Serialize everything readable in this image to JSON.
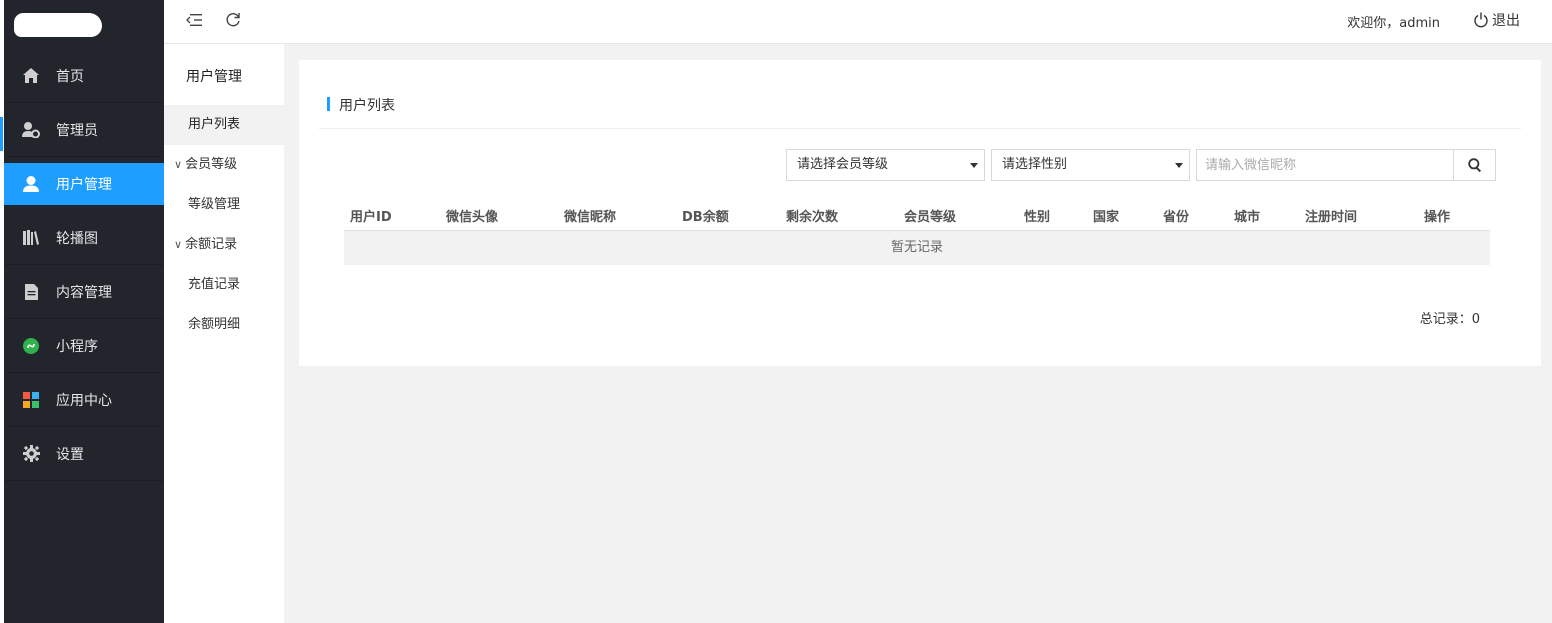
{
  "sidebar": {
    "logo_alt": "",
    "items": [
      {
        "label": "首页",
        "icon": "home-icon"
      },
      {
        "label": "管理员",
        "icon": "admin-user-icon"
      },
      {
        "label": "用户管理",
        "icon": "user-icon"
      },
      {
        "label": "轮播图",
        "icon": "books-icon"
      },
      {
        "label": "内容管理",
        "icon": "document-icon"
      },
      {
        "label": "小程序",
        "icon": "miniprogram-icon"
      },
      {
        "label": "应用中心",
        "icon": "apps-icon"
      },
      {
        "label": "设置",
        "icon": "gear-icon"
      }
    ],
    "active_color": "#1e9fff",
    "background": "#22252c"
  },
  "subnav": {
    "title": "用户管理",
    "items": [
      {
        "label": "用户列表",
        "active": true
      },
      {
        "label": "会员等级",
        "group": true
      },
      {
        "label": "等级管理"
      },
      {
        "label": "余额记录",
        "group": true
      },
      {
        "label": "充值记录"
      },
      {
        "label": "余额明细"
      }
    ]
  },
  "topbar": {
    "welcome": "欢迎你，admin",
    "logout_label": "退出"
  },
  "card": {
    "title": "用户列表",
    "filters": {
      "level_placeholder": "请选择会员等级",
      "gender_placeholder": "请选择性别",
      "nickname_placeholder": "请输入微信昵称"
    },
    "columns": [
      "用户ID",
      "微信头像",
      "微信昵称",
      "DB余额",
      "剩余次数",
      "会员等级",
      "性别",
      "国家",
      "省份",
      "城市",
      "注册时间",
      "操作"
    ],
    "empty_text": "暂无记录",
    "total_label": "总记录：0"
  }
}
